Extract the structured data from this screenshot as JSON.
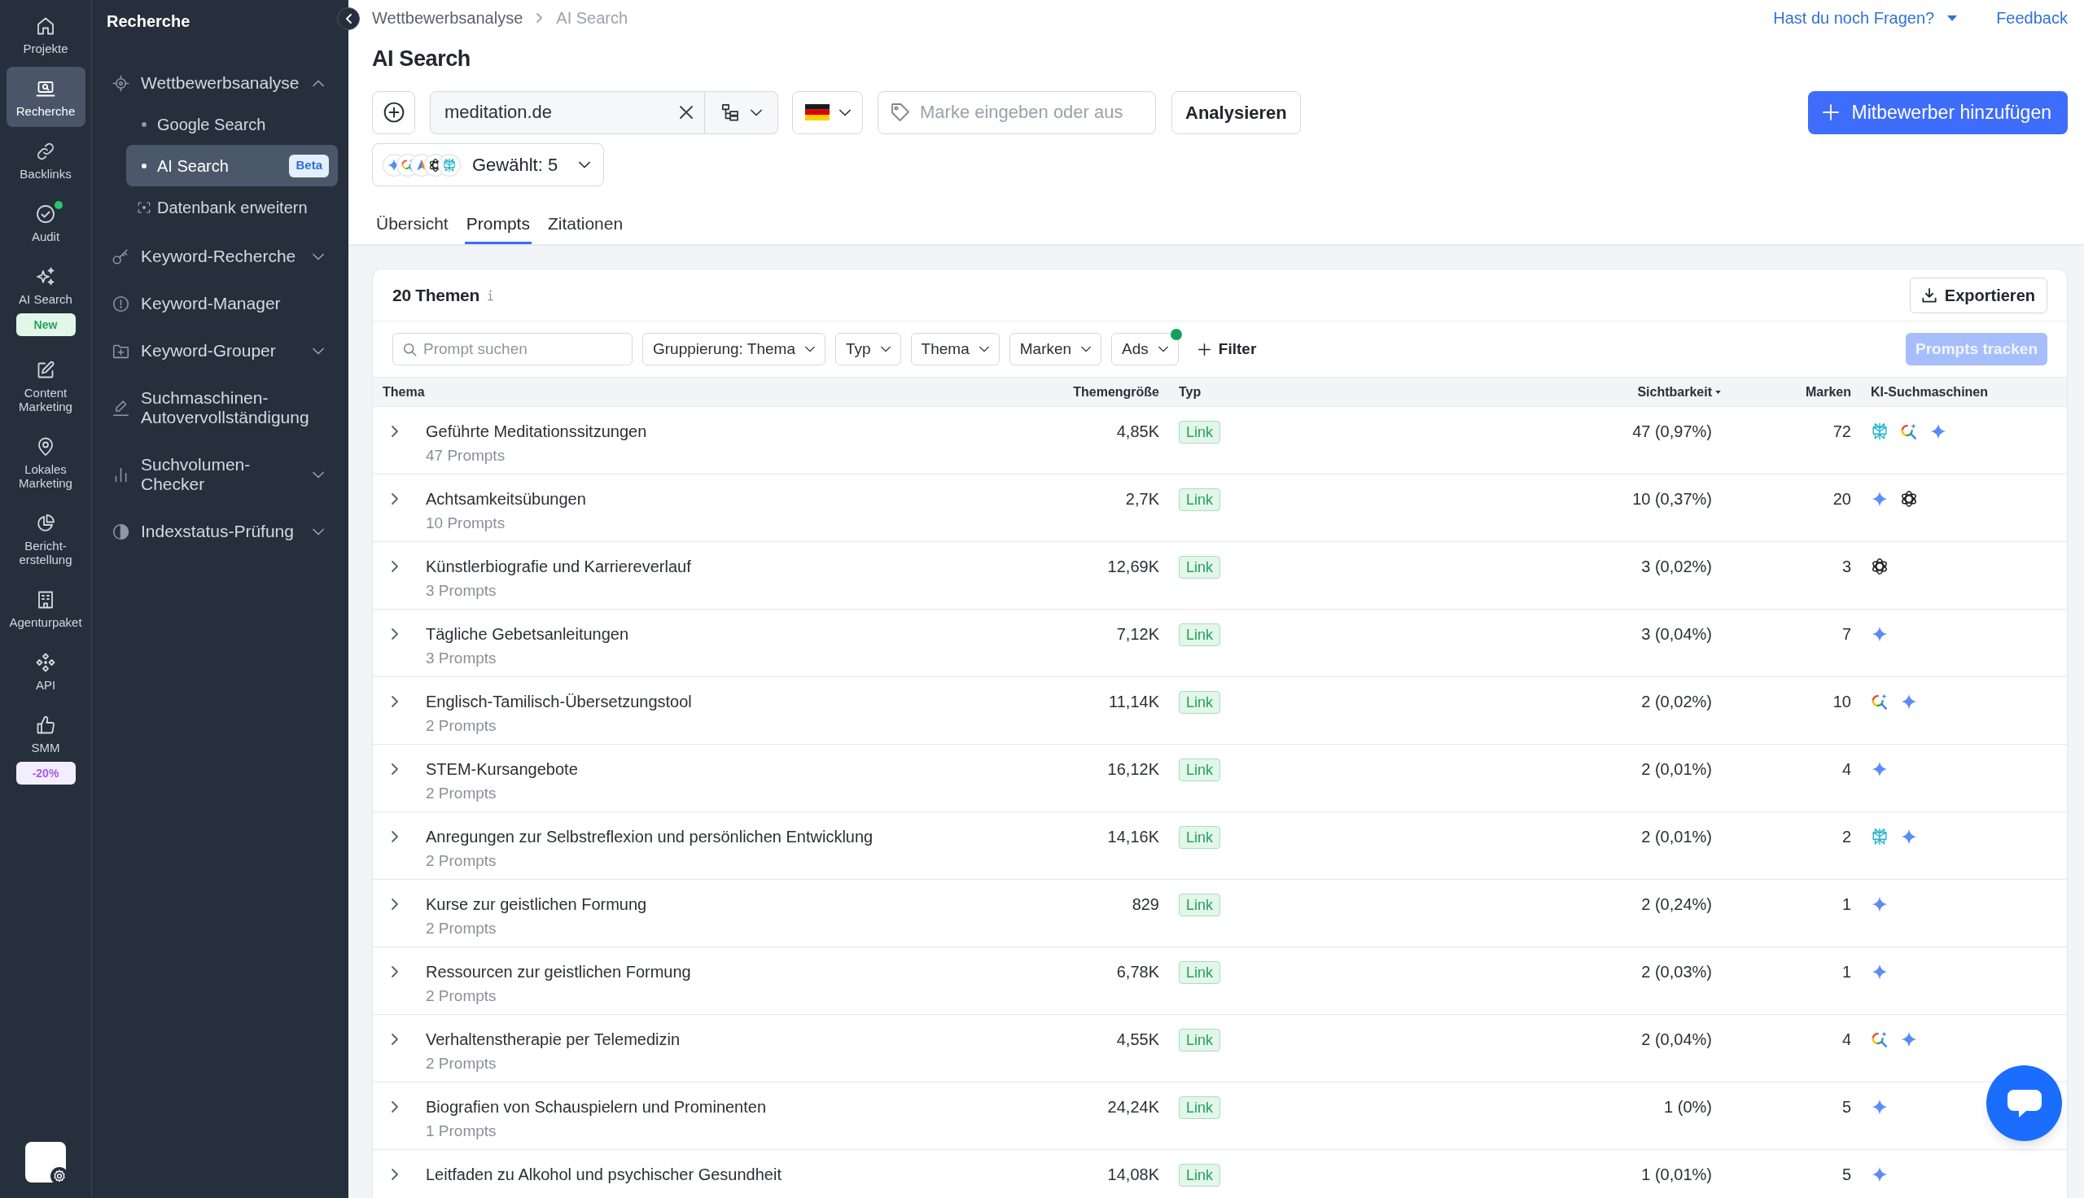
{
  "rail": {
    "items": [
      {
        "label": "Projekte",
        "selected": false,
        "notification": false
      },
      {
        "label": "Recherche",
        "selected": true,
        "notification": false
      },
      {
        "label": "Backlinks",
        "selected": false,
        "notification": false
      },
      {
        "label": "Audit",
        "selected": false,
        "notification": true
      },
      {
        "label": "AI Search",
        "selected": false,
        "notification": false,
        "badge": {
          "text": "New",
          "kind": "new"
        }
      },
      {
        "label": "Content Marketing",
        "selected": false,
        "notification": false
      },
      {
        "label": "Lokales Marketing",
        "selected": false,
        "notification": false
      },
      {
        "label": "Bericht-erstellung",
        "selected": false,
        "notification": false
      },
      {
        "label": "Agenturpaket",
        "selected": false,
        "notification": false
      },
      {
        "label": "API",
        "selected": false,
        "notification": false
      },
      {
        "label": "SMM",
        "selected": false,
        "notification": false,
        "badge": {
          "text": "-20%",
          "kind": "discount"
        }
      }
    ]
  },
  "sidebar": {
    "title": "Recherche",
    "items": [
      {
        "label": "Wettbewerbsanalyse",
        "expanded": true,
        "children": [
          {
            "label": "Google Search",
            "kind": "page",
            "selected": false
          },
          {
            "label": "AI Search",
            "kind": "page",
            "selected": true,
            "badge": "Beta"
          },
          {
            "label": "Datenbank erweitern",
            "kind": "action",
            "selected": false
          }
        ]
      },
      {
        "label": "Keyword-Recherche",
        "expanded": false
      },
      {
        "label": "Keyword-Manager"
      },
      {
        "label": "Keyword-Grouper",
        "expanded": false
      },
      {
        "label": "Suchmaschinen-Autovervollständigung"
      },
      {
        "label": "Suchvolumen-Checker",
        "expanded": false
      },
      {
        "label": "Indexstatus-Prüfung",
        "expanded": false
      }
    ]
  },
  "breadcrumb": [
    {
      "label": "Wettbewerbsanalyse"
    },
    {
      "label": "AI Search"
    }
  ],
  "header_links": [
    {
      "label": "Hast du noch Fragen?",
      "kind": "menu"
    },
    {
      "label": "Feedback",
      "kind": "link"
    }
  ],
  "title": "AI Search",
  "toolbar": {
    "domain_field": {
      "value": "meditation.de"
    },
    "brand_field": {
      "placeholder": "Marke eingeben oder aus"
    },
    "analyze_button": "Analysieren",
    "add_competitor_button": "Mitbewerber hinzufügen"
  },
  "engine_selector": {
    "label": "Gewählt: 5",
    "engines": [
      {
        "kind": "sparkle"
      },
      {
        "kind": "lens"
      },
      {
        "kind": "triangle"
      },
      {
        "kind": "atom"
      },
      {
        "kind": "lattice"
      }
    ]
  },
  "tabs": [
    {
      "label": "Übersicht",
      "selected": false
    },
    {
      "label": "Prompts",
      "selected": true
    },
    {
      "label": "Zitationen",
      "selected": false
    }
  ],
  "card": {
    "title": "20 Themen",
    "export_button": "Exportieren",
    "search": {
      "placeholder": "Prompt suchen"
    },
    "filters": [
      {
        "label": "Gruppierung: Thema",
        "dot": false
      },
      {
        "label": "Typ",
        "dot": false
      },
      {
        "label": "Thema",
        "dot": false
      },
      {
        "label": "Marken",
        "dot": false
      },
      {
        "label": "Ads",
        "dot": true
      }
    ],
    "add_filter": "Filter",
    "track_button": {
      "label": "Prompts tracken",
      "disabled": true
    }
  },
  "table": {
    "columns": [
      {
        "label": "Thema",
        "sorted": false
      },
      {
        "label": "Themengröße",
        "sorted": false
      },
      {
        "label": "Typ",
        "sorted": false
      },
      {
        "label": "Sichtbarkeit",
        "sorted": true
      },
      {
        "label": "Marken",
        "sorted": false
      },
      {
        "label": "KI-Suchmaschinen",
        "sorted": false
      }
    ],
    "rows": [
      {
        "topic": "Geführte Meditationssitzungen",
        "prompts": "47 Prompts",
        "size": "4,85K",
        "type": "Link",
        "visibility": "47 (0,97%)",
        "brands": "72",
        "expanded": false,
        "engines": [
          {
            "kind": "lattice"
          },
          {
            "kind": "lens"
          },
          {
            "kind": "sparkle"
          }
        ]
      },
      {
        "topic": "Achtsamkeitsübungen",
        "prompts": "10 Prompts",
        "size": "2,7K",
        "type": "Link",
        "visibility": "10 (0,37%)",
        "brands": "20",
        "expanded": false,
        "engines": [
          {
            "kind": "sparkle"
          },
          {
            "kind": "atom"
          }
        ]
      },
      {
        "topic": "Künstlerbiografie und Karriereverlauf",
        "prompts": "3 Prompts",
        "size": "12,69K",
        "type": "Link",
        "visibility": "3 (0,02%)",
        "brands": "3",
        "expanded": false,
        "engines": [
          {
            "kind": "atom"
          }
        ]
      },
      {
        "topic": "Tägliche Gebetsanleitungen",
        "prompts": "3 Prompts",
        "size": "7,12K",
        "type": "Link",
        "visibility": "3 (0,04%)",
        "brands": "7",
        "expanded": false,
        "engines": [
          {
            "kind": "sparkle"
          }
        ]
      },
      {
        "topic": "Englisch-Tamilisch-Übersetzungstool",
        "prompts": "2 Prompts",
        "size": "11,14K",
        "type": "Link",
        "visibility": "2 (0,02%)",
        "brands": "10",
        "expanded": false,
        "engines": [
          {
            "kind": "lens"
          },
          {
            "kind": "sparkle"
          }
        ]
      },
      {
        "topic": "STEM-Kursangebote",
        "prompts": "2 Prompts",
        "size": "16,12K",
        "type": "Link",
        "visibility": "2 (0,01%)",
        "brands": "4",
        "expanded": false,
        "engines": [
          {
            "kind": "sparkle"
          }
        ]
      },
      {
        "topic": "Anregungen zur Selbstreflexion und persönlichen Entwicklung",
        "prompts": "2 Prompts",
        "size": "14,16K",
        "type": "Link",
        "visibility": "2 (0,01%)",
        "brands": "2",
        "expanded": false,
        "engines": [
          {
            "kind": "lattice"
          },
          {
            "kind": "sparkle"
          }
        ]
      },
      {
        "topic": "Kurse zur geistlichen Formung",
        "prompts": "2 Prompts",
        "size": "829",
        "type": "Link",
        "visibility": "2 (0,24%)",
        "brands": "1",
        "expanded": false,
        "engines": [
          {
            "kind": "sparkle"
          }
        ]
      },
      {
        "topic": "Ressourcen zur geistlichen Formung",
        "prompts": "2 Prompts",
        "size": "6,78K",
        "type": "Link",
        "visibility": "2 (0,03%)",
        "brands": "1",
        "expanded": false,
        "engines": [
          {
            "kind": "sparkle"
          }
        ]
      },
      {
        "topic": "Verhaltenstherapie per Telemedizin",
        "prompts": "2 Prompts",
        "size": "4,55K",
        "type": "Link",
        "visibility": "2 (0,04%)",
        "brands": "4",
        "expanded": false,
        "engines": [
          {
            "kind": "lens"
          },
          {
            "kind": "sparkle"
          }
        ]
      },
      {
        "topic": "Biografien von Schauspielern und Prominenten",
        "prompts": "1 Prompts",
        "size": "24,24K",
        "type": "Link",
        "visibility": "1 (0%)",
        "brands": "5",
        "expanded": false,
        "engines": [
          {
            "kind": "sparkle"
          }
        ]
      },
      {
        "topic": "Leitfaden zu Alkohol und psychischer Gesundheit",
        "size": "14,08K",
        "type": "Link",
        "visibility": "1 (0,01%)",
        "brands": "5",
        "expanded": false,
        "engines": [
          {
            "kind": "sparkle"
          }
        ]
      }
    ]
  }
}
